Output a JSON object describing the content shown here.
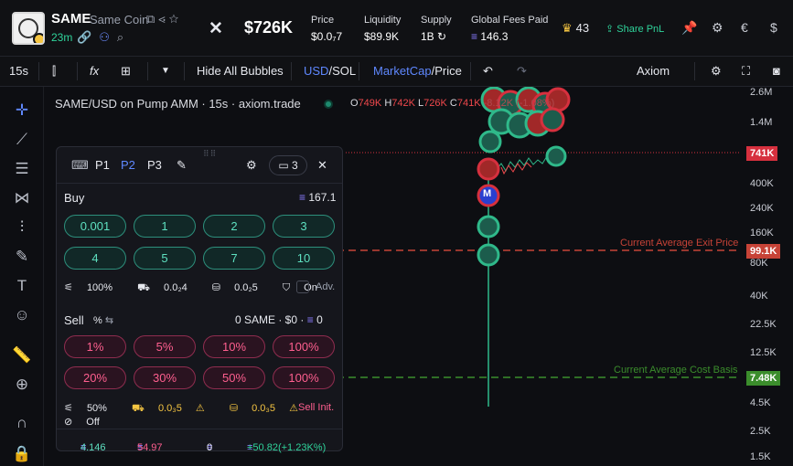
{
  "header": {
    "symbol": "SAME",
    "name": "Same Coin",
    "age": "23m",
    "market_cap": "$726K",
    "stats": [
      {
        "label": "Price",
        "value": "$0.0₇7"
      },
      {
        "label": "Liquidity",
        "value": "$89.9K"
      },
      {
        "label": "Supply",
        "value": "1B"
      },
      {
        "label": "Global Fees Paid",
        "value": "146.3"
      }
    ],
    "crown_count": "43",
    "share_label": "Share PnL"
  },
  "toolbar": {
    "interval": "15s",
    "hide_bubbles": "Hide All Bubbles",
    "usd": "USD",
    "sol": "/SOL",
    "mcap": "MarketCap",
    "price": "/Price",
    "axiom": "Axiom"
  },
  "chart": {
    "title": "SAME/USD on Pump AMM · 15s · axiom.trade",
    "ohlc": {
      "o": "749K",
      "h": "742K",
      "l": "726K",
      "c": "741K",
      "chg": "-8.12K (-1.08%)"
    },
    "y_labels": [
      "2.6M",
      "1.4M",
      "400K",
      "240K",
      "160K",
      "80K",
      "40K",
      "22.5K",
      "12.5K",
      "4.5K",
      "2.5K",
      "1.5K"
    ],
    "tags": [
      {
        "value": "741K",
        "color": "#d6303e"
      },
      {
        "value": "99.1K",
        "color": "#c74337"
      },
      {
        "value": "7.48K",
        "color": "#3b8d2c"
      }
    ],
    "exit_label": "Current Average Exit Price",
    "cost_label": "Current Average Cost Basis",
    "bubble_m": "M"
  },
  "panel": {
    "presets": [
      "P1",
      "P2",
      "P3"
    ],
    "count": "3",
    "buy_label": "Buy",
    "buy_balance": "167.1",
    "buy_amounts": [
      "0.001",
      "1",
      "2",
      "3",
      "4",
      "5",
      "7",
      "10"
    ],
    "buy_opts": {
      "slippage": "100%",
      "priority": "0.0₂4",
      "bribe": "0.0₂5",
      "mev": "On",
      "adv": "Adv."
    },
    "sell_label": "Sell",
    "sell_unit": "%",
    "sell_balance": "0 SAME · $0 · ",
    "sell_sol": "0",
    "sell_amounts": [
      "1%",
      "5%",
      "10%",
      "100%",
      "20%",
      "30%",
      "50%",
      "100%"
    ],
    "sell_opts": {
      "slippage": "50%",
      "priority": "0.0₃5",
      "bribe": "0.0₃5",
      "mev": "Off",
      "init": "Sell Init."
    },
    "footer": {
      "bought": "4.146",
      "sold": "54.97",
      "holding": "0",
      "pnl": "+50.82(+1.23K%)"
    }
  },
  "colors": {
    "buy": "#5ee0c0",
    "sell": "#ff5f8f",
    "accent": "#5f88ff",
    "up": "#2fd49b",
    "down": "#f0484c"
  }
}
